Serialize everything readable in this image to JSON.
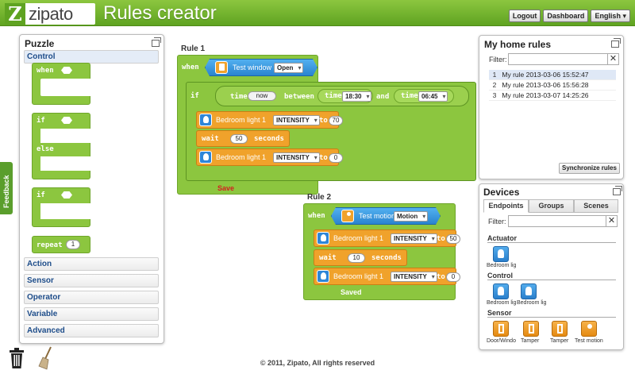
{
  "header": {
    "logo_text": "zipato",
    "logo_letter": "Z",
    "title": "Rules creator",
    "buttons": {
      "logout": "Logout",
      "dashboard": "Dashboard",
      "language": "English"
    }
  },
  "feedback_label": "Feedback",
  "puzzle": {
    "title": "Puzzle",
    "categories": [
      "Control",
      "Action",
      "Sensor",
      "Operator",
      "Variable",
      "Advanced"
    ],
    "blocks": {
      "when": "when",
      "if": "if",
      "else": "else",
      "if2": "if",
      "repeat": "repeat",
      "repeat_value": "1"
    }
  },
  "rule1": {
    "title": "Rule 1",
    "when": "when",
    "trigger_device": "Test window 1",
    "trigger_state": "Open",
    "if": "if",
    "time": "time",
    "now": "now",
    "between": "between",
    "time_a": "time",
    "value_a": "18:30",
    "and": "and",
    "time_b": "time",
    "value_b": "06:45",
    "action1_device": "Bedroom light 1",
    "action1_attr": "INTENSITY",
    "action1_to": "to",
    "action1_value": "70",
    "wait": "wait",
    "wait_value": "50",
    "seconds": "seconds",
    "action2_device": "Bedroom light 1",
    "action2_attr": "INTENSITY",
    "action2_to": "to",
    "action2_value": "0",
    "save": "Save"
  },
  "rule2": {
    "title": "Rule 2",
    "when": "when",
    "trigger_device": "Test motion",
    "trigger_state": "Motion",
    "action1_device": "Bedroom light 1",
    "action1_attr": "INTENSITY",
    "action1_to": "to",
    "action1_value": "50",
    "wait": "wait",
    "wait_value": "10",
    "seconds": "seconds",
    "action2_device": "Bedroom light 1",
    "action2_attr": "INTENSITY",
    "action2_to": "to",
    "action2_value": "0",
    "saved": "Saved"
  },
  "my_rules": {
    "title": "My home rules",
    "filter_label": "Filter:",
    "clear": "✕",
    "rows": [
      {
        "num": "1",
        "name": "My rule 2013-03-06 15:52:47"
      },
      {
        "num": "2",
        "name": "My rule 2013-03-06 15:56:28"
      },
      {
        "num": "3",
        "name": "My rule 2013-03-07 14:25:26"
      }
    ],
    "sync_label": "Synchronize rules"
  },
  "devices": {
    "title": "Devices",
    "tabs": [
      "Endpoints",
      "Groups",
      "Scenes"
    ],
    "filter_label": "Filter:",
    "clear": "✕",
    "sections": {
      "actuator": "Actuator",
      "control": "Control",
      "sensor": "Sensor"
    },
    "actuator_items": [
      "Bedroom lig"
    ],
    "control_items": [
      "Bedroom lig",
      "Bedroom lig"
    ],
    "sensor_items": [
      "Door/Windo",
      "Tamper",
      "Tamper",
      "Test motion"
    ]
  },
  "footer": "© 2011, Zipato, All rights reserved",
  "colors": {
    "header_green": "#5fa321",
    "block_green": "#8cc63f",
    "block_orange": "#f0a22b",
    "device_blue": "#2a84cf",
    "save_red": "#d32020"
  }
}
